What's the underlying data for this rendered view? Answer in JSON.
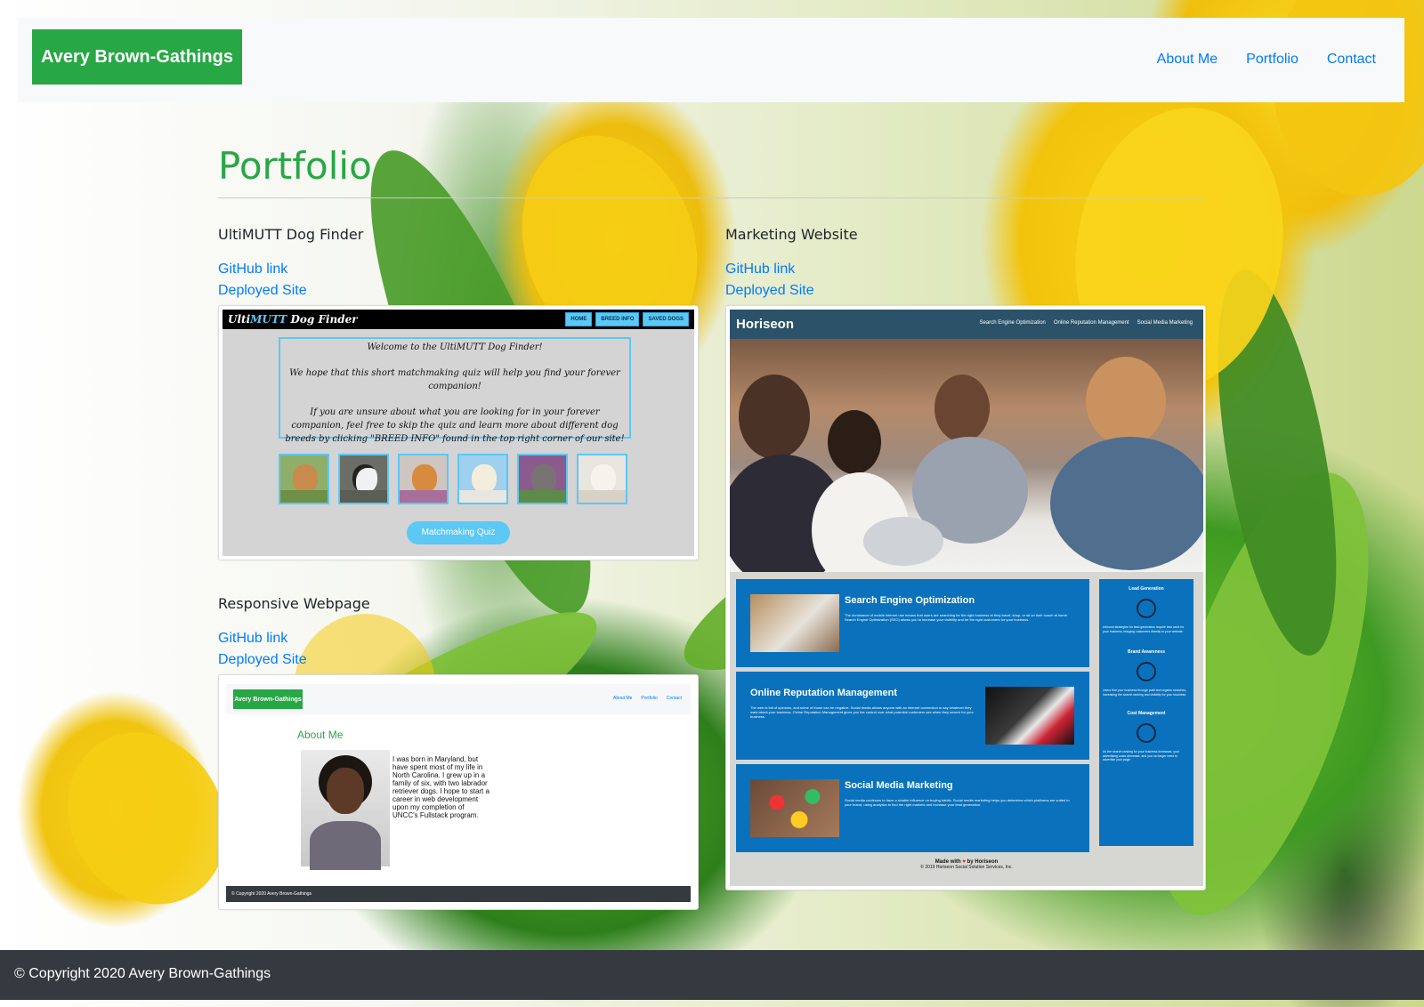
{
  "brand": "Avery Brown-Gathings",
  "nav": [
    "About Me",
    "Portfolio",
    "Contact"
  ],
  "page_title": "Portfolio",
  "projects": [
    {
      "title": "UltiMUTT Dog Finder",
      "github": "GitHub link",
      "deployed": "Deployed Site"
    },
    {
      "title": "Marketing Website",
      "github": "GitHub link",
      "deployed": "Deployed Site"
    },
    {
      "title": "Responsive Webpage",
      "github": "GitHub link",
      "deployed": "Deployed Site"
    }
  ],
  "dog_finder": {
    "logo_a": "Ulti",
    "logo_b": "MUTT",
    "logo_c": " Dog Finder",
    "nav": [
      "HOME",
      "BREED INFO",
      "SAVED DOGS"
    ],
    "welcome": "Welcome to the UltiMUTT Dog Finder!",
    "hope": "We hope that this short matchmaking quiz will help you find your forever companion!",
    "unsure": "If you are unsure about what you are looking for in your forever companion, feel free to skip the quiz and learn more about different dog breeds by clicking \"BREED INFO\" found in the top right corner of our site!",
    "quiz_button": "Matchmaking Quiz"
  },
  "responsive": {
    "brand": "Avery Brown-Gathings",
    "nav": [
      "About Me",
      "Portfolio",
      "Contact"
    ],
    "title": "About Me",
    "bio": "I was born in Maryland, but have spent most of my life in North Carolina. I grew up in a family of six, with two labrador retriever dogs. I hope to start a career in web development upon my completion of UNCC's Fullstack program.",
    "footer": "© Copyright 2020 Avery Brown-Gathings"
  },
  "horiseon": {
    "logo": "Horiseon",
    "nav": [
      "Search Engine Optimization",
      "Online Reputation Management",
      "Social Media Marketing"
    ],
    "cards": [
      {
        "title": "Search Engine Optimization",
        "text": "The dominance of mobile internet use means that users are searching for the right business at they travel, shop, or sit on their couch at home. Search Engine Optimization (SEO) allows you to increase your visibility and be the right customers for your business."
      },
      {
        "title": "Online Reputation Management",
        "text": "The web is full of opinions, and some of those can be negative. Social media allows anyone with an internet connection to say whatever they want about your business. Online Reputation Management gives you the control over what potential customers see when they search for your business."
      },
      {
        "title": "Social Media Marketing",
        "text": "Social media continues to have a sizable influence on buying habits. Social media marketing helps you determine which platforms are suited to your brand, using analytics to find the right markets and increase your lead generation."
      }
    ],
    "side": [
      {
        "title": "Lead Generation",
        "text": "Inbound strategies for lead generation require less work for your business, bringing customers directly to your website."
      },
      {
        "title": "Brand Awareness",
        "text": "Users find your business through paid and organic searches, increasing the search ranking and visibility for your business."
      },
      {
        "title": "Cost Management",
        "text": "As the search ranking for your business increases, your advertising costs decrease, and you no longer need to advertise your page."
      }
    ],
    "footer_made_a": "Made with",
    "footer_made_b": "by Horiseon",
    "footer_copy": "© 2019 Horiseon Social Solution Services, Inc."
  },
  "footer": "© Copyright 2020 Avery Brown-Gathings",
  "colors": {
    "brand_green": "#28a745",
    "link_blue": "#007bff",
    "footer_dark": "#343a40"
  }
}
